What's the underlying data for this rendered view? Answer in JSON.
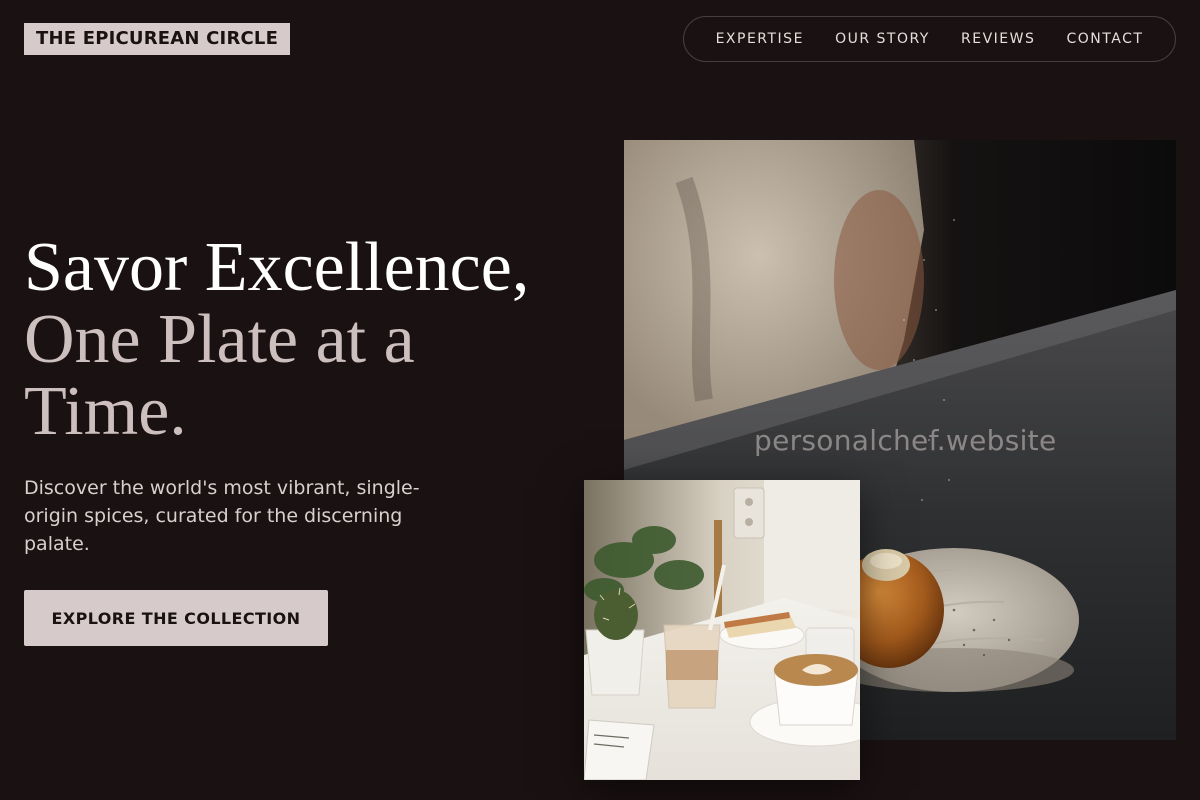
{
  "brand": {
    "name": "THE EPICUREAN CIRCLE"
  },
  "nav": {
    "items": [
      {
        "label": "EXPERTISE"
      },
      {
        "label": "OUR STORY"
      },
      {
        "label": "REVIEWS"
      },
      {
        "label": "CONTACT"
      }
    ]
  },
  "hero": {
    "headline_line1": "Savor Excellence,",
    "headline_line2": "One Plate at a Time.",
    "subtitle": "Discover the world's most vibrant, single-origin spices, curated for the discerning palate.",
    "cta_label": "EXPLORE THE COLLECTION"
  },
  "images": {
    "main_alt": "Chef seasoning a dessert on a scalloped ceramic dish",
    "secondary_alt": "Table with latte, iced coffee, cheesecake and cactus plant"
  },
  "watermark": {
    "text": "personalchef.website"
  },
  "colors": {
    "background": "#1a1112",
    "accent": "#d6cbca",
    "headline_primary": "#ffffff",
    "headline_secondary": "#cdbfbd"
  }
}
